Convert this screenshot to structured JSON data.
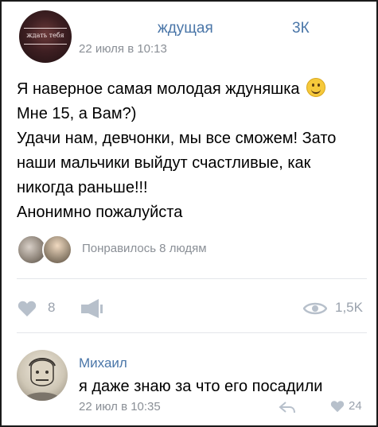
{
  "post": {
    "group_name": "ждущая",
    "group_count": "3К",
    "avatar_text": "ждать тебя",
    "time": "22 июля в 10:13",
    "text_lines": [
      "Я наверное самая молодая ждуняшка",
      "Мне 15, а Вам?)",
      "Удачи нам, девчонки, мы все сможем! Зато",
      "наши мальчики выйдут счастливые, как",
      "никогда раньше!!!",
      "Анонимно пожалуйста"
    ],
    "liked_by": "Понравилось 8 людям",
    "likes": "8",
    "views": "1,5K"
  },
  "comment": {
    "author": "Михаил",
    "text": "я даже знаю за что его посадили",
    "time": "22 июл в 10:35",
    "likes": "24"
  },
  "colors": {
    "link": "#4a76a8",
    "meta": "#8a8f96",
    "icon": "#9aa2ad"
  },
  "icons": [
    "heart-icon",
    "share-icon",
    "eye-icon",
    "reply-icon"
  ]
}
